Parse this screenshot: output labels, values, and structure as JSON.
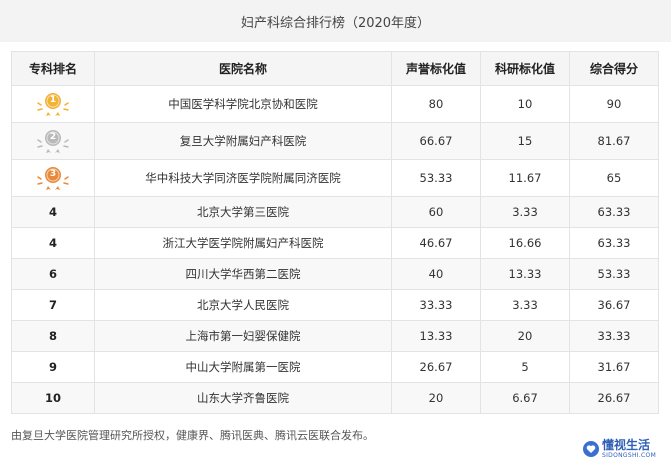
{
  "title": "妇产科综合排行榜（2020年度）",
  "table": {
    "headers": [
      "专科排名",
      "医院名称",
      "声誉标化值",
      "科研标化值",
      "综合得分"
    ],
    "rows": [
      {
        "rank": "1",
        "medal": "gold",
        "hospital": "中国医学科学院北京协和医院",
        "reputation": "80",
        "research": "10",
        "score": "90"
      },
      {
        "rank": "2",
        "medal": "silver",
        "hospital": "复旦大学附属妇产科医院",
        "reputation": "66.67",
        "research": "15",
        "score": "81.67"
      },
      {
        "rank": "3",
        "medal": "bronze",
        "hospital": "华中科技大学同济医学院附属同济医院",
        "reputation": "53.33",
        "research": "11.67",
        "score": "65"
      },
      {
        "rank": "4",
        "hospital": "北京大学第三医院",
        "reputation": "60",
        "research": "3.33",
        "score": "63.33"
      },
      {
        "rank": "4",
        "hospital": "浙江大学医学院附属妇产科医院",
        "reputation": "46.67",
        "research": "16.66",
        "score": "63.33"
      },
      {
        "rank": "6",
        "hospital": "四川大学华西第二医院",
        "reputation": "40",
        "research": "13.33",
        "score": "53.33"
      },
      {
        "rank": "7",
        "hospital": "北京大学人民医院",
        "reputation": "33.33",
        "research": "3.33",
        "score": "36.67"
      },
      {
        "rank": "8",
        "hospital": "上海市第一妇婴保健院",
        "reputation": "13.33",
        "research": "20",
        "score": "33.33"
      },
      {
        "rank": "9",
        "hospital": "中山大学附属第一医院",
        "reputation": "26.67",
        "research": "5",
        "score": "31.67"
      },
      {
        "rank": "10",
        "hospital": "山东大学齐鲁医院",
        "reputation": "20",
        "research": "6.67",
        "score": "26.67"
      }
    ]
  },
  "medal_colors": {
    "gold": "#f2b233",
    "silver": "#b9b9b9",
    "bronze": "#e88a3a"
  },
  "footer": "由复旦大学医院管理研究所授权，健康界、腾讯医典、腾讯云医联合发布。",
  "logo": {
    "cn": "懂视生活",
    "en": "SIDONGSHI.COM",
    "icon": "heart-icon"
  }
}
